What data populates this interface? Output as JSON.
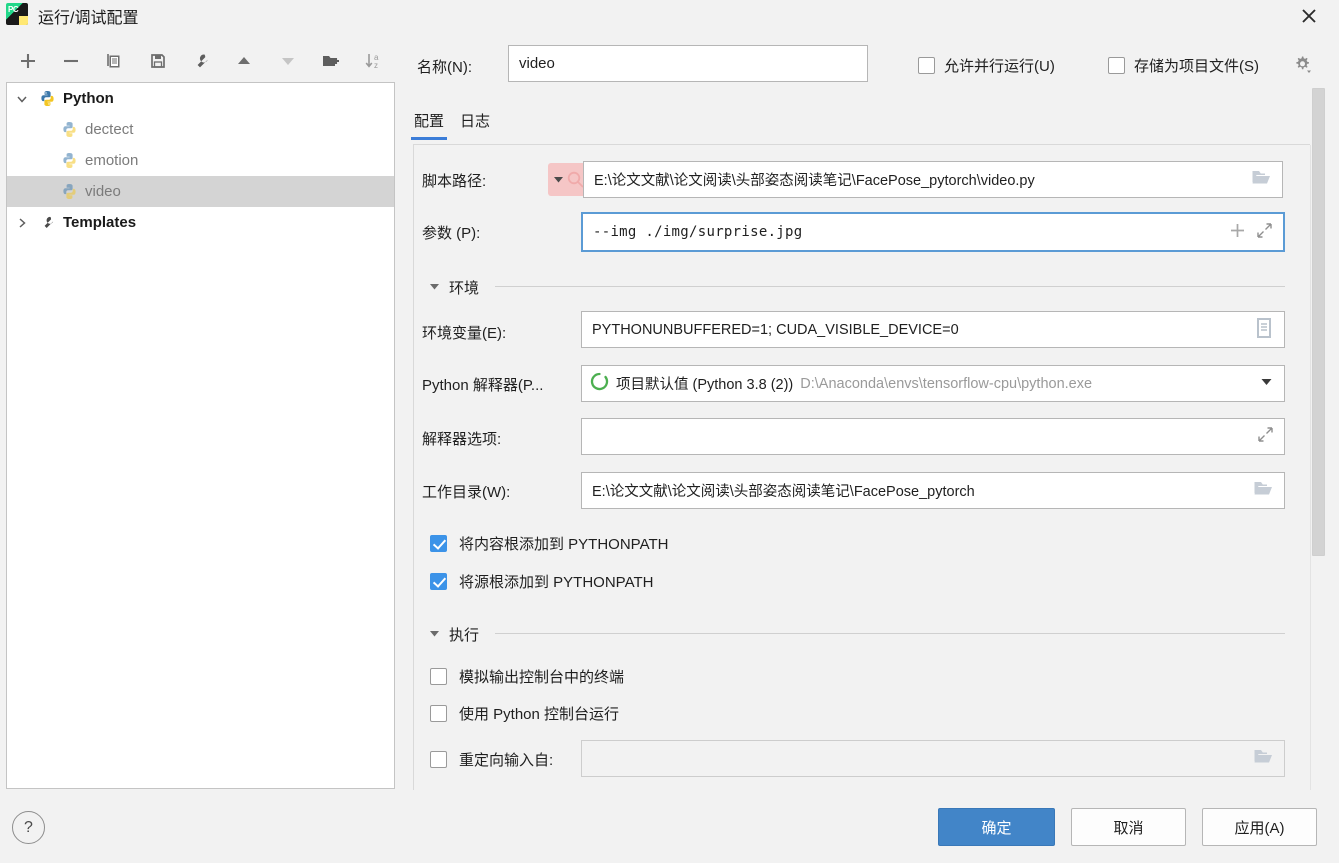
{
  "window": {
    "title": "运行/调试配置",
    "app_icon": "pycharm-icon",
    "close_icon": "close-icon"
  },
  "toolbar": {
    "buttons": [
      {
        "name": "add-configuration-button",
        "icon": "plus-icon"
      },
      {
        "name": "remove-configuration-button",
        "icon": "minus-icon"
      },
      {
        "name": "copy-configuration-button",
        "icon": "copy-icon"
      },
      {
        "name": "save-configuration-button",
        "icon": "save-icon"
      },
      {
        "name": "edit-templates-button",
        "icon": "wrench-icon"
      },
      {
        "name": "move-up-button",
        "icon": "arrow-up-icon"
      },
      {
        "name": "move-down-button",
        "icon": "arrow-down-icon"
      },
      {
        "name": "new-folder-button",
        "icon": "folder-add-icon"
      },
      {
        "name": "sort-configurations-button",
        "icon": "sort-az-icon"
      }
    ]
  },
  "tree": {
    "nodes": [
      {
        "label": "Python",
        "level": 0,
        "expanded": true,
        "icon": "python-icon",
        "selected": false
      },
      {
        "label": "dectect",
        "level": 1,
        "icon": "python-file-icon",
        "selected": false
      },
      {
        "label": "emotion",
        "level": 1,
        "icon": "python-file-icon",
        "selected": false
      },
      {
        "label": "video",
        "level": 1,
        "icon": "python-file-icon",
        "selected": true
      },
      {
        "label": "Templates",
        "level": 0,
        "expanded": false,
        "icon": "wrench-icon",
        "selected": false
      }
    ]
  },
  "name_field": {
    "label": "名称(N):",
    "value": "video"
  },
  "top_options": [
    {
      "label": "允许并行运行(U)",
      "checked": false,
      "name": "allow-parallel-run-checkbox"
    },
    {
      "label": "存储为项目文件(S)",
      "checked": false,
      "name": "store-as-project-file-checkbox"
    }
  ],
  "gear_icon": "gear-icon",
  "tabs": [
    {
      "label": "配置",
      "active": true
    },
    {
      "label": "日志",
      "active": false
    }
  ],
  "form": {
    "script_path": {
      "label": "脚本路径:",
      "value": "E:\\论文文献\\论文阅读\\头部姿态阅读笔记\\FacePose_pytorch\\video.py",
      "prefix_icon": "search-dropdown-icon",
      "browse_icon": "folder-icon"
    },
    "parameters": {
      "label": "参数 (P):",
      "value": "--img ./img/surprise.jpg",
      "focused": true,
      "insert_icon": "plus-icon",
      "expand_icon": "expand-icon"
    },
    "environment_section": {
      "title": "环境",
      "collapse_icon": "triangle-down-icon"
    },
    "env_vars": {
      "label": "环境变量(E):",
      "value": "PYTHONUNBUFFERED=1; CUDA_VISIBLE_DEVICE=0",
      "edit_icon": "list-edit-icon"
    },
    "interpreter": {
      "label": "Python 解释器(P...",
      "value": "项目默认值 (Python 3.8 (2))",
      "path": "D:\\Anaconda\\envs\\tensorflow-cpu\\python.exe",
      "status_icon": "python-env-icon",
      "dropdown_icon": "chevron-down-icon"
    },
    "interpreter_options": {
      "label": "解释器选项:",
      "value": "",
      "expand_icon": "expand-icon"
    },
    "working_dir": {
      "label": "工作目录(W):",
      "value": "E:\\论文文献\\论文阅读\\头部姿态阅读笔记\\FacePose_pytorch",
      "browse_icon": "folder-icon"
    },
    "path_checkboxes": [
      {
        "label": "将内容根添加到 PYTHONPATH",
        "checked": true,
        "name": "add-content-roots-checkbox"
      },
      {
        "label": "将源根添加到 PYTHONPATH",
        "checked": true,
        "name": "add-source-roots-checkbox"
      }
    ],
    "execution_section": {
      "title": "执行",
      "collapse_icon": "triangle-down-icon"
    },
    "execution_checkboxes": [
      {
        "label": "模拟输出控制台中的终端",
        "checked": false,
        "name": "emulate-terminal-checkbox"
      },
      {
        "label": "使用 Python 控制台运行",
        "checked": false,
        "name": "run-with-python-console-checkbox"
      }
    ],
    "redirect_input": {
      "label": "重定向输入自:",
      "checked": false,
      "value": "",
      "browse_icon": "folder-icon"
    }
  },
  "footer": {
    "help_label": "?",
    "ok_label": "确定",
    "cancel_label": "取消",
    "apply_label": "应用(A)"
  }
}
